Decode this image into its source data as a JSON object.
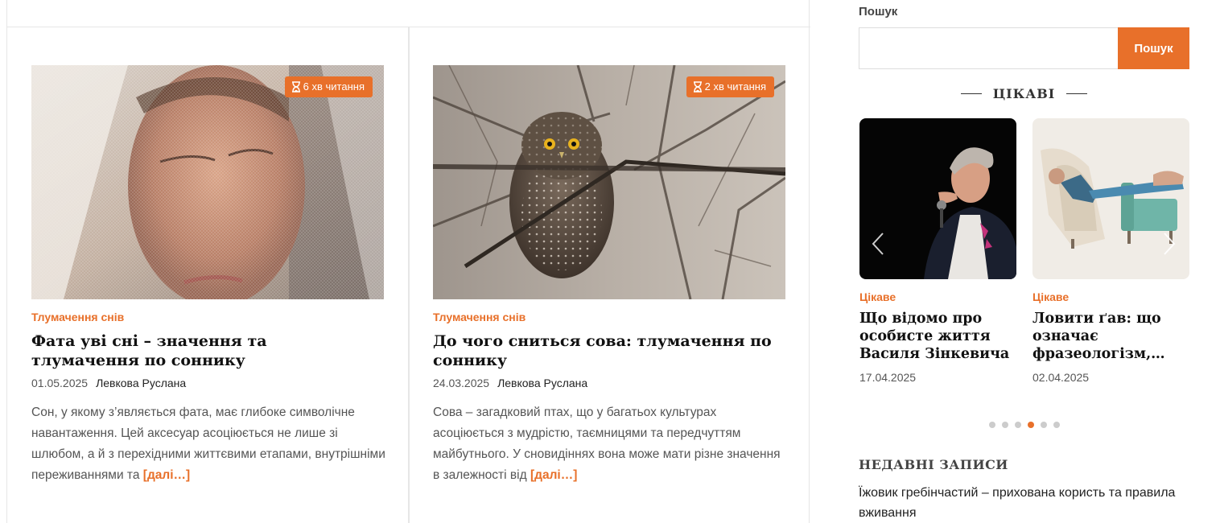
{
  "posts": [
    {
      "badge": "6 хв читання",
      "category": "Тлумачення снів",
      "title": "Фата уві сні – значення та тлумачення по соннику",
      "date": "01.05.2025",
      "author": "Левкова Руслана",
      "excerpt": "Сон, у якому з’являється фата, має глибоке символічне навантаження. Цей аксесуар асоціюється не лише зі шлюбом, а й з перехідними життєвими етапами, внутрішніми переживаннями та",
      "more": "[далі…]"
    },
    {
      "badge": "2 хв читання",
      "category": "Тлумачення снів",
      "title": "До чого сниться сова: тлумачення по соннику",
      "date": "24.03.2025",
      "author": "Левкова Руслана",
      "excerpt": "Сова – загадковий птах, що у багатьох культурах асоціюється з мудрістю, таємницями та передчуттям майбутнього. У сновидіннях вона може мати різне значення в залежності від",
      "more": "[далі…]"
    }
  ],
  "sidebar": {
    "search_label": "Пошук",
    "search_placeholder": "",
    "search_button": "Пошук",
    "section_title": "ЦІКАВІ",
    "slides": [
      {
        "category": "Цікаве",
        "title": "Що відомо про особисте життя Василя Зінкевича",
        "date": "17.04.2025"
      },
      {
        "category": "Цікаве",
        "title": "Ловити ґав: що означає фразеологізм,…",
        "date": "02.04.2025"
      }
    ],
    "dots_total": 6,
    "active_dot": 4,
    "recent_title": "НЕДАВНІ ЗАПИСИ",
    "recent_items": [
      "Їжовик гребінчастий – прихована користь та правила вживання"
    ]
  },
  "colors": {
    "accent": "#e8702a",
    "border": "#e6e6e6"
  },
  "icons": {
    "badge": "hourglass-icon",
    "prev": "chevron-left-icon",
    "next": "chevron-right-icon"
  }
}
